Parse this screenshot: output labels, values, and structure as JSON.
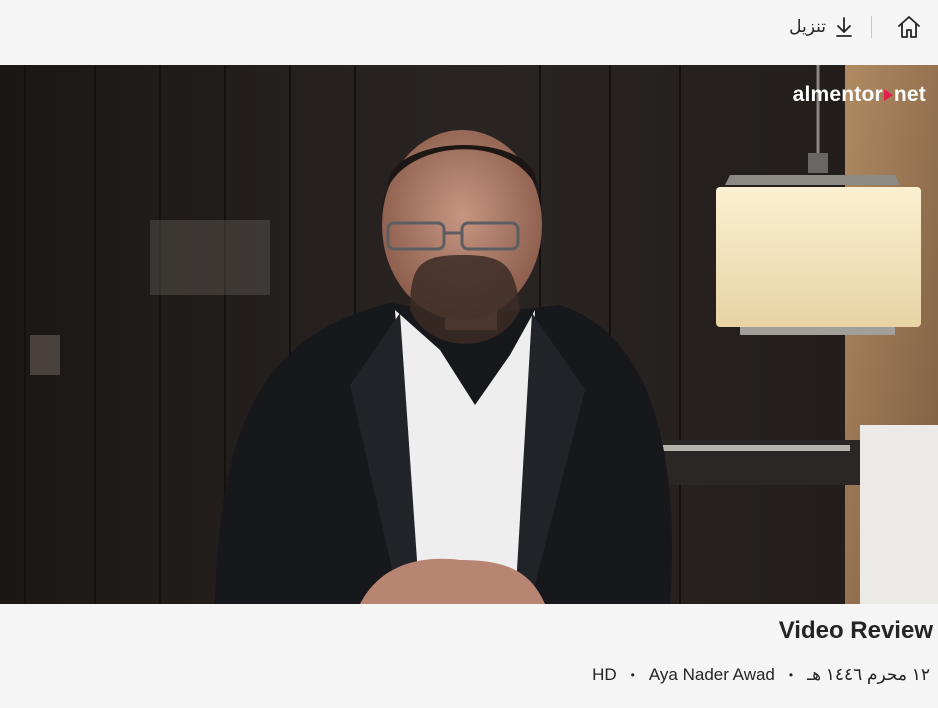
{
  "toolbar": {
    "home_icon": "home-icon",
    "download_label": "تنزيل",
    "download_icon": "download-icon"
  },
  "video": {
    "logo_text_a": "almentor",
    "logo_text_b": "net"
  },
  "info": {
    "title": "Video Review",
    "date": "١٢ محرم ١٤٤٦ هـ",
    "author": "Aya Nader Awad",
    "quality": "HD",
    "bullet": "•"
  },
  "colors": {
    "background": "#f5f5f5",
    "text": "#242424",
    "logo_accent": "#e3204d"
  }
}
